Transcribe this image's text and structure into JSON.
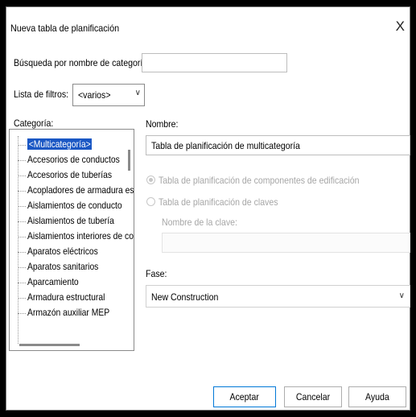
{
  "dialog": {
    "title": "Nueva tabla de planificación",
    "close_glyph": "X"
  },
  "search": {
    "label": "Búsqueda por nombre de categoría:",
    "value": ""
  },
  "filters": {
    "label": "Lista de filtros:",
    "selected": "<varios>"
  },
  "category": {
    "label": "Categoría:",
    "items": [
      "<Multicategoría>",
      "Accesorios de conductos",
      "Accesorios de tuberías",
      "Acopladores de armadura est",
      "Aislamientos de conducto",
      "Aislamientos de tubería",
      "Aislamientos interiores de con",
      "Aparatos eléctricos",
      "Aparatos sanitarios",
      "Aparcamiento",
      "Armadura estructural",
      "Armazón auxiliar MEP"
    ],
    "selected_index": 0
  },
  "name": {
    "label": "Nombre:",
    "value": "Tabla de planificación de multicategoría"
  },
  "options": {
    "radio1": "Tabla de planificación de componentes de edificación",
    "radio2": "Tabla de planificación de claves",
    "key_name_label": "Nombre de la clave:",
    "key_name_value": ""
  },
  "phase": {
    "label": "Fase:",
    "selected": "New Construction"
  },
  "buttons": {
    "accept": "Aceptar",
    "cancel": "Cancelar",
    "help": "Ayuda"
  },
  "colors": {
    "selection": "#1a57c4",
    "primary_border": "#0078d7",
    "frame": "#000000"
  }
}
